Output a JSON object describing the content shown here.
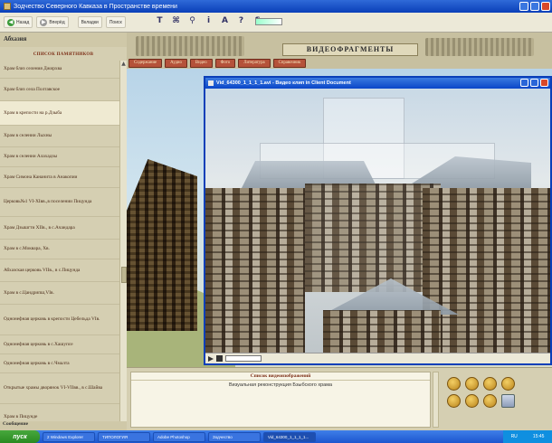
{
  "window": {
    "title": "Зодчество Северного Кавказа в Пространстве времени"
  },
  "toolbar": {
    "back_label": "Назад",
    "forward_label": "Вперёд",
    "tab_a": "Вкладки",
    "tab_b": "Поиск",
    "icons": [
      "print-icon",
      "map-icon",
      "find-icon",
      "info-icon",
      "font-icon",
      "help-icon",
      "text-icon"
    ]
  },
  "sidebar": {
    "title": "Абхазия",
    "list_header": "СПИСОК ПАМЯТНИКОВ",
    "items": [
      "Храм близ селения Джирхва",
      "Храм близ села Полтавское",
      "Храм в крепости на р.Дзыба",
      "Храм в селении Лыхны",
      "Храм в селении Алахадзы",
      "Храм Симона Кананита в Анакопии",
      "Церковь№1 VI-XIвв.,в поселении Пицунда",
      "Храм Дзышгти XIIв., в с.Ачандара",
      "Храм в с.Моквара, Xв.",
      "Абхазская церковь VIIв., в с.Пицунда",
      "Храм в с.Цандрипш,VIв.",
      "Однонефная церковь в крепости Цебельда VIв.",
      "Однонефная церковь в с.Хашупсе",
      "Однонефная церковь в с.Чмалта",
      "Открытые храмы дворянок VI-VIIвв., в с.Шайва",
      "Храм в Пицунде"
    ],
    "selected_index": 2,
    "footer": "Сообщение"
  },
  "banner": {
    "title": "ВИДЕОФРАГМЕНТЫ",
    "tabs": [
      "Содержание",
      "Аудио",
      "Видео",
      "Фото",
      "Литература",
      "Справочник"
    ]
  },
  "video_window": {
    "title": "Vid_64300_1_1_1_1.avi - Видео клип in Client Document"
  },
  "caption": {
    "header": "Список видеоизображений",
    "text": "Визуальная реконструкция Бзыбского храма"
  },
  "nav_buttons": [
    "prev-icon",
    "up-icon",
    "down-icon",
    "next-icon",
    "first-icon",
    "home-icon",
    "last-icon",
    "exit-icon"
  ],
  "taskbar": {
    "start_label": "пуск",
    "tasks": [
      "2 Windows Explorer",
      "ТИПОЛОГИЯ",
      "Adobe Photoshop",
      "Зодчество",
      "Vid_64300_1_1_1_1..."
    ],
    "tray_lang": "RU",
    "clock": "15:45"
  },
  "colors": {
    "accent": "#b5523a",
    "heading": "#7a2a12",
    "titlebar": "#0a3fb8"
  }
}
